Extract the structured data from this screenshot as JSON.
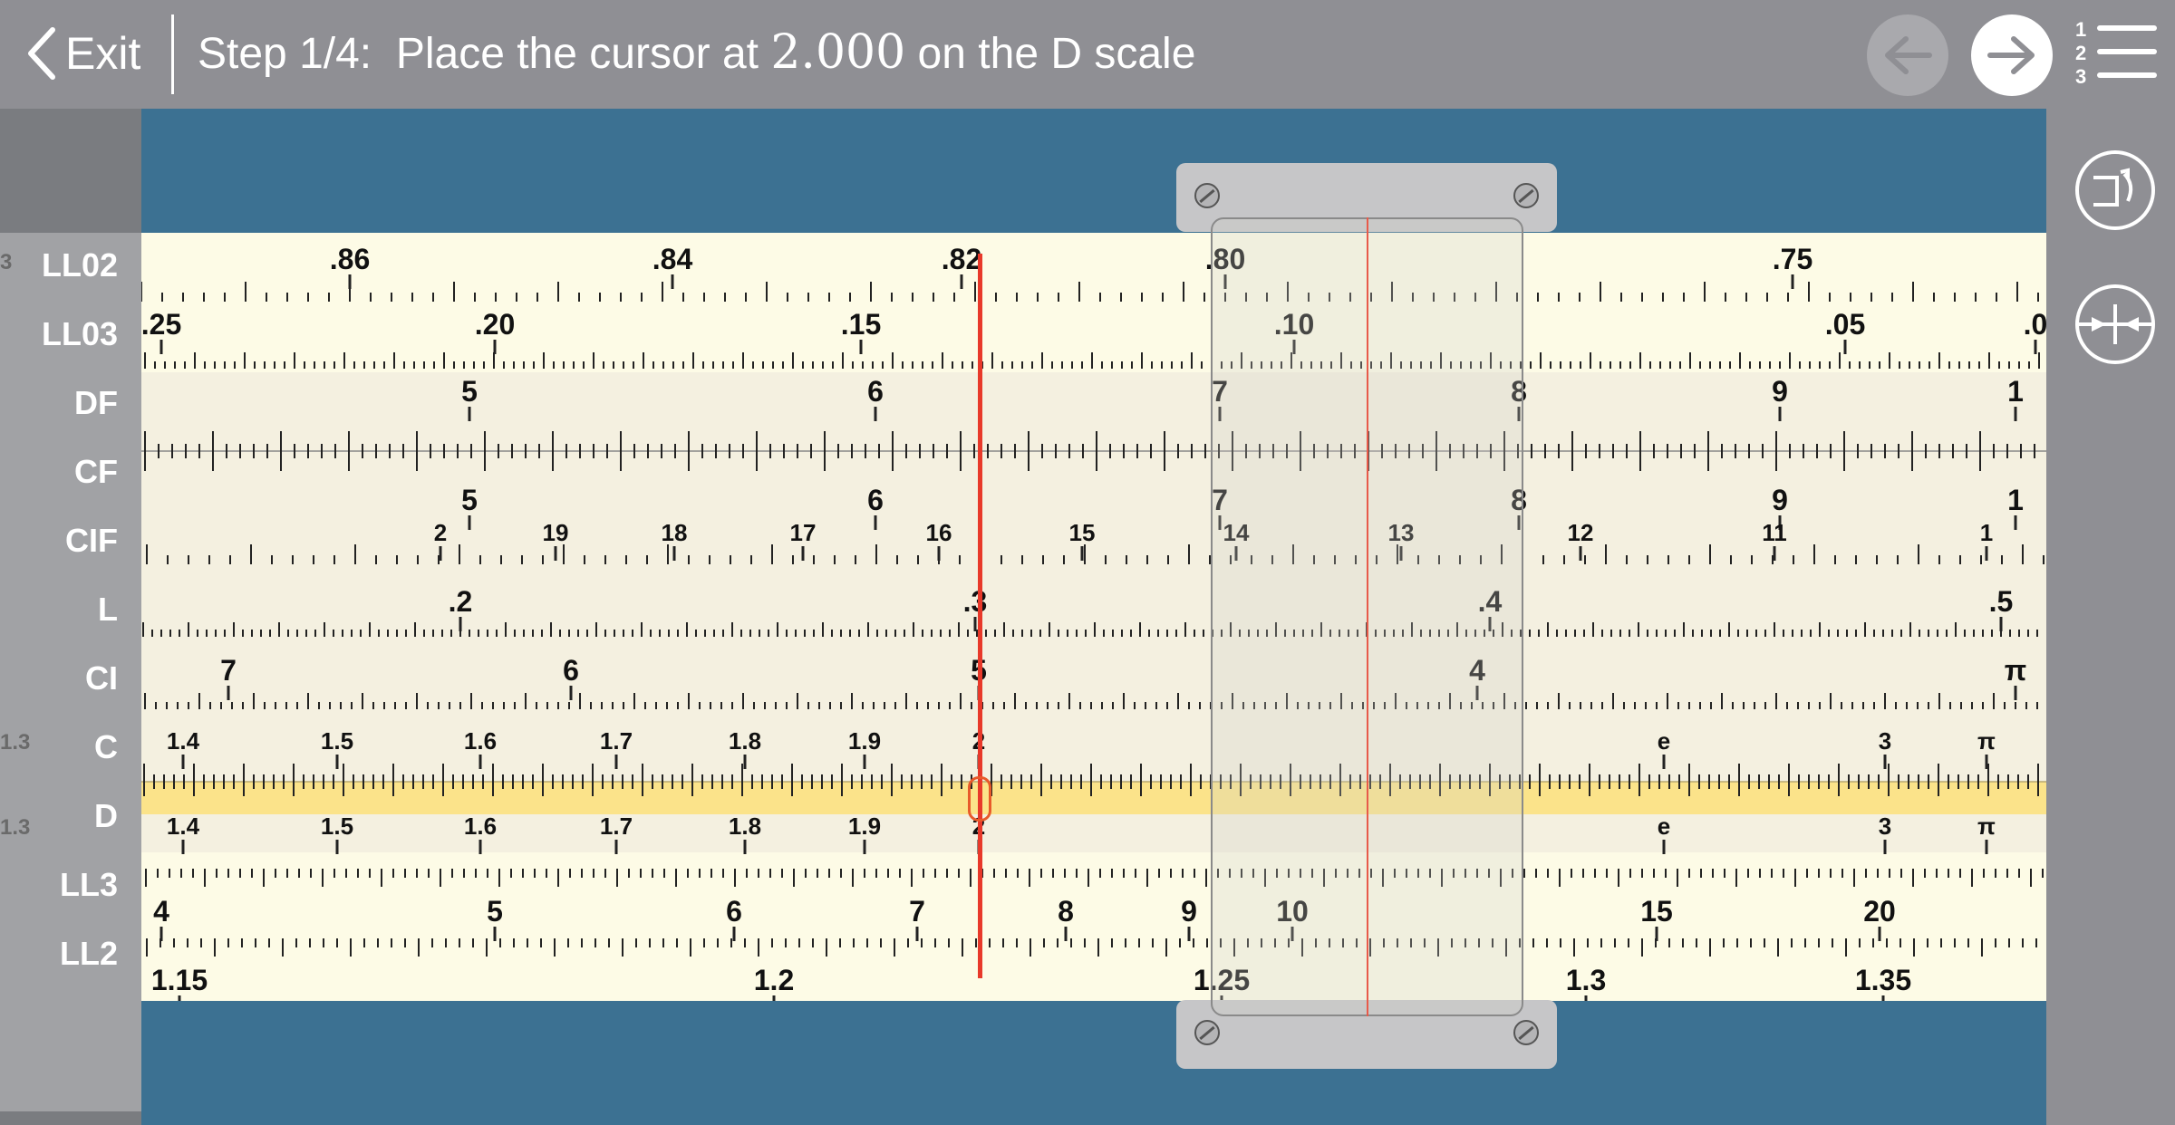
{
  "toolbar": {
    "exit_label": "Exit",
    "step_prefix": "Step 1/4:  Place the cursor at ",
    "step_value": "2.000",
    "step_suffix": " on the D scale",
    "prev_icon": "arrow-left-icon",
    "next_icon": "arrow-right-icon",
    "steps_menu_icon": "numbered-list-icon"
  },
  "sidebar": {
    "flip_icon": "flip-rule-icon",
    "center_icon": "center-cursor-icon"
  },
  "scale_labels": [
    "LL02",
    "LL03",
    "DF",
    "CF",
    "CIF",
    "L",
    "CI",
    "C",
    "D",
    "LL3",
    "LL2"
  ],
  "colors": {
    "rule_bg": "#fdfbe6",
    "slide_bg": "#f4f0e0",
    "frame_blue": "#3c7192",
    "highlight": "#fbe38a",
    "marker_red": "#e8392a"
  },
  "scales": {
    "ll02": [
      ".86",
      ".84",
      ".82",
      ".80",
      ".75"
    ],
    "ll03": [
      ".25",
      ".20",
      ".15",
      ".10",
      ".05",
      ".0"
    ],
    "df": [
      "5",
      "6",
      "7",
      "8",
      "9",
      "1"
    ],
    "cf": [
      "5",
      "6",
      "7",
      "8",
      "9",
      "1"
    ],
    "cif": [
      "2",
      "19",
      "18",
      "17",
      "16",
      "15",
      "14",
      "13",
      "12",
      "11",
      "1"
    ],
    "l": [
      ".2",
      ".3",
      ".4",
      ".5"
    ],
    "ci": [
      "7",
      "6",
      "5",
      "4",
      "π"
    ],
    "c": [
      "1.4",
      "1.5",
      "1.6",
      "1.7",
      "1.8",
      "1.9",
      "2",
      "e",
      "3",
      "π"
    ],
    "d": [
      "1.4",
      "1.5",
      "1.6",
      "1.7",
      "1.8",
      "1.9",
      "2",
      "e",
      "3",
      "π"
    ],
    "ll3": [
      "4",
      "5",
      "6",
      "7",
      "8",
      "9",
      "10",
      "15",
      "20"
    ],
    "ll2": [
      "1.15",
      "1.2",
      "1.25",
      "1.3",
      "1.35"
    ],
    "left_c": "1.3",
    "left_d": "1.3",
    "left_ll02": "3"
  }
}
